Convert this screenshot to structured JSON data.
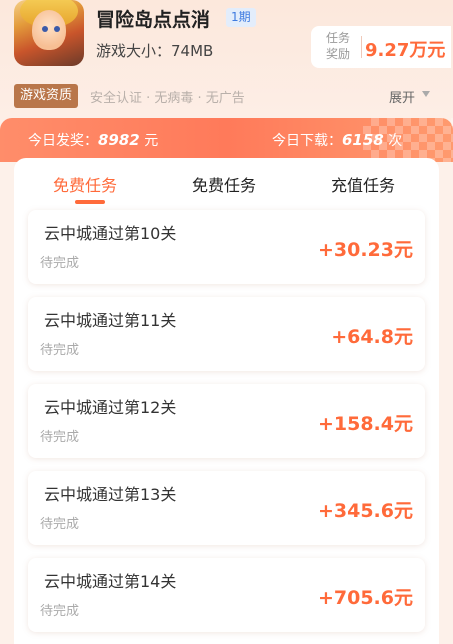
{
  "game": {
    "title": "冒险岛点点消",
    "period": "1期",
    "size": "游戏大小：74MB",
    "reward_label": "任务奖励",
    "reward_value": "9.27万元"
  },
  "info": {
    "tag": "游戏资质",
    "safety": "安全认证 · 无病毒 · 无广告",
    "expand": "展开"
  },
  "stats": {
    "left_label": "今日发奖：",
    "left_value": "8982",
    "left_unit": " 元",
    "right_label": "今日下载：",
    "right_value": "6158",
    "right_unit": " 次"
  },
  "tabs": [
    {
      "label": "免费任务",
      "active": true
    },
    {
      "label": "免费任务",
      "active": false
    },
    {
      "label": "充值任务",
      "active": false
    }
  ],
  "tasks": [
    {
      "name": "云中城通过第10关",
      "status": "待完成",
      "reward": "+30.23元"
    },
    {
      "name": "云中城通过第11关",
      "status": "待完成",
      "reward": "+64.8元"
    },
    {
      "name": "云中城通过第12关",
      "status": "待完成",
      "reward": "+158.4元"
    },
    {
      "name": "云中城通过第13关",
      "status": "待完成",
      "reward": "+345.6元"
    },
    {
      "name": "云中城通过第14关",
      "status": "待完成",
      "reward": "+705.6元"
    }
  ],
  "colors": {
    "accent": "#ff6a3a",
    "banner": "#ff8d6a",
    "tag": "#b9764a",
    "period_badge": "#3f7be0"
  }
}
